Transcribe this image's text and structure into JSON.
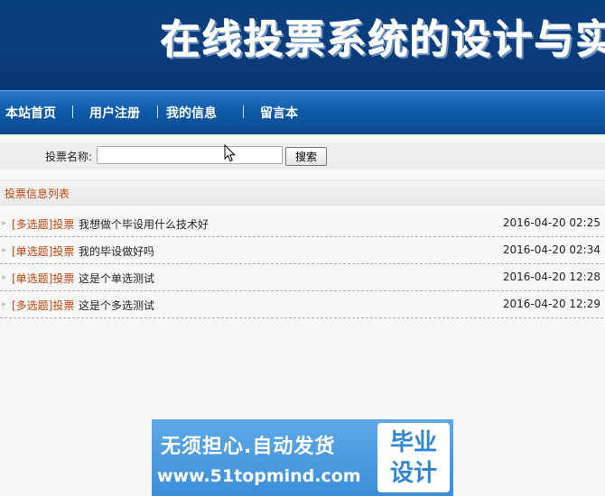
{
  "banner": {
    "title": "在线投票系统的设计与实"
  },
  "nav": {
    "items": [
      {
        "label": "本站首页"
      },
      {
        "label": "用户注册"
      },
      {
        "label": "我的信息"
      },
      {
        "label": "留言本"
      }
    ]
  },
  "search": {
    "label": "投票名称:",
    "value": "",
    "placeholder": "",
    "button_label": "搜索"
  },
  "section": {
    "title": "投票信息列表"
  },
  "votes": [
    {
      "type": "[多选题]投票",
      "name": "我想做个毕设用什么技术好",
      "date": "2016-04-20 02:25"
    },
    {
      "type": "[单选题]投票",
      "name": "我的毕设做好吗",
      "date": "2016-04-20 02:34"
    },
    {
      "type": "[单选题]投票",
      "name": "这是个单选测试",
      "date": "2016-04-20 12:28"
    },
    {
      "type": "[多选题]投票",
      "name": "这是个多选测试",
      "date": "2016-04-20 12:29"
    }
  ],
  "ad": {
    "line1": "无须担心.自动发货",
    "line2": "www.51topmind.com",
    "box_line1": "毕业",
    "box_line2": "设计"
  },
  "icons": {
    "bullet": "double-chevron-right-icon",
    "cursor": "mouse-pointer-icon"
  },
  "colors": {
    "banner": "#0b3d7c",
    "nav": "#0f5aa8",
    "accent": "#c0440c"
  }
}
